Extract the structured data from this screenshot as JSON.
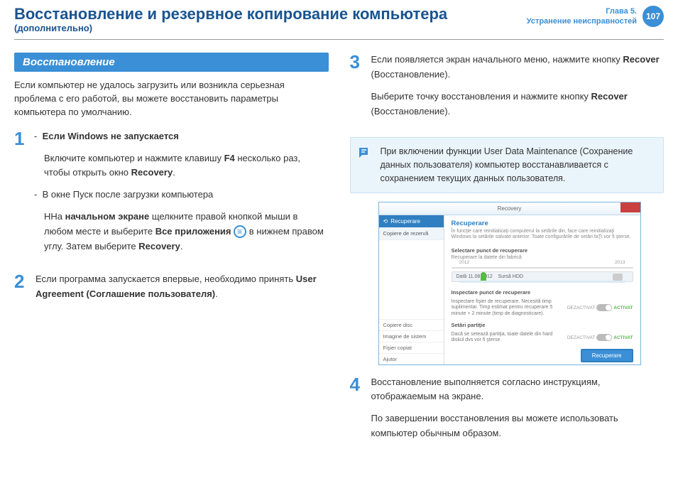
{
  "header": {
    "title": "Восстановление и резервное копирование компьютера",
    "subtitle": "(дополнительно)",
    "chapter_line1": "Глава 5.",
    "chapter_line2": "Устранение неисправностей",
    "page": "107"
  },
  "left": {
    "section_title": "Восстановление",
    "intro": "Если компьютер не удалось загрузить или возникла серьезная проблема с его работой, вы можете восстановить параметры компьютера по умолчанию.",
    "step1": {
      "bullet1_title": "Если Windows не запускается",
      "bullet1_body_a": "Включите компьютер и нажмите клавишу ",
      "bullet1_key": "F4",
      "bullet1_body_b": " несколько раз, чтобы открыть окно ",
      "bullet1_bold": "Recovery",
      "bullet1_body_c": ".",
      "bullet2_title": "В окне Пуск после загрузки компьютера",
      "bullet2_body_a": "ННа ",
      "bullet2_bold1": "начальном экране",
      "bullet2_body_b": " щелкните правой кнопкой мыши в любом месте и выберите ",
      "bullet2_bold2": "Все приложения",
      "bullet2_body_c": " в нижнем правом углу. Затем выберите ",
      "bullet2_bold3": "Recovery",
      "bullet2_body_d": "."
    },
    "step2": {
      "body_a": "Если программа запускается впервые, необходимо принять ",
      "bold": "User Agreement (Соглашение пользователя)",
      "body_b": "."
    }
  },
  "right": {
    "step3": {
      "line1_a": "Если появляется экран начального меню, нажмите кнопку ",
      "line1_bold": "Recover",
      "line1_b": " (Восстановление).",
      "line2_a": "Выберите точку восстановления и нажмите кнопку ",
      "line2_bold": "Recover",
      "line2_b": " (Восстановление)."
    },
    "note": "При включении функции User Data Maintenance (Сохранение данных пользователя) компьютер восстанавливается с сохранением текущих данных пользователя.",
    "screenshot": {
      "window_title": "Recovery",
      "side_top": "Recuperare",
      "side_item": "Copiere de rezervă",
      "side_b1": "Copiere disc",
      "side_b2": "Imagine de sistem",
      "side_b3": "Fişier copiat",
      "side_b4": "Ajutor",
      "main_title": "Recuperare",
      "main_sub": "În funcţie care reinitializaţi computerul la setările din, face care reinitializaţi Windows la setările salvate anterior. Toate configurările de setări faŢi vor fi şterse.",
      "select_label": "Selectare punct de recuperare",
      "select_sub": "Recuperare la datele din fabrică",
      "tl_l": "2012",
      "tl_r": "2013",
      "filter_date": "Dată   11.08.2012",
      "filter_src": "Sursă   HDD",
      "opt1_title": "Inspectare punct de recuperare",
      "opt1_body": "Inspectare fişier de recuperare. Necesită timp suplimentar. Timp estimat pentru recuperare 5 minute + 2 minute (timp de diagnosticare).",
      "opt2_title": "Setări partiţie",
      "opt2_body": "Dacă se setează partiţia, toate datele din hard diskul dvs vor fi şterse.",
      "toggle_off": "DEZACTIVAT",
      "toggle_on": "ACTIVAT",
      "button": "Recuperare"
    },
    "step4": {
      "line1": "Восстановление выполняется согласно инструкциям, отображаемым на экране.",
      "line2": "По завершении восстановления вы можете использовать компьютер обычным образом."
    }
  }
}
